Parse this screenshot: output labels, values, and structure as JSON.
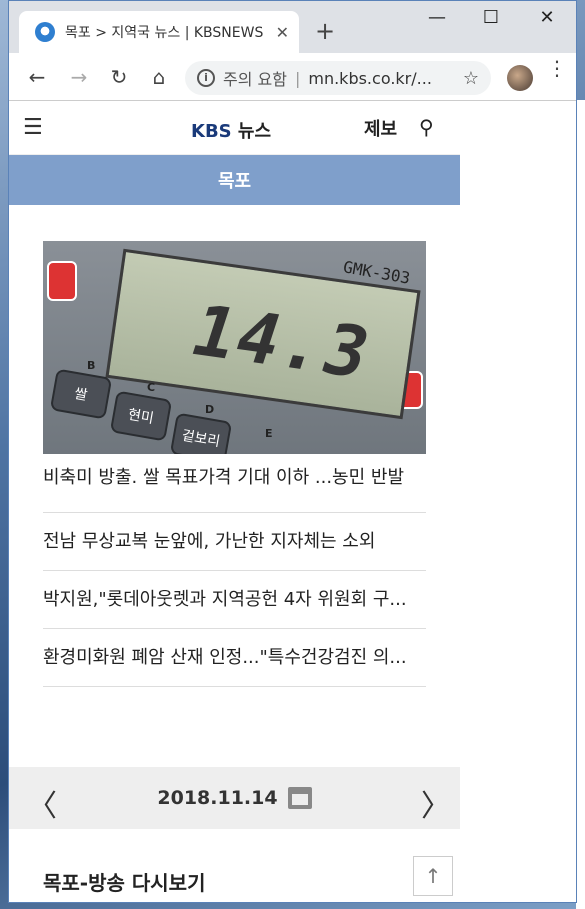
{
  "browser": {
    "tab_title": "목포 > 지역국 뉴스 | KBSNEWS",
    "tab_close": "✕",
    "new_tab": "+",
    "window_min": "—",
    "window_max": "☐",
    "window_close": "✕",
    "security_label": "주의 요함",
    "url": "mn.kbs.co.kr/...",
    "back": "←",
    "forward": "→",
    "reload": "↻",
    "home": "⌂",
    "star": "☆",
    "menu": "⋮",
    "info": "i"
  },
  "site": {
    "menu_icon": "☰",
    "logo_kbs": "KBS",
    "logo_news": "뉴스",
    "report_label": "제보",
    "search_icon": "⚲",
    "region": "목포"
  },
  "thumbnail": {
    "digits": "14.3",
    "device_label": "GMK-303",
    "keys": [
      "쌀",
      "현미",
      "겉보리"
    ],
    "key_letters": [
      "B",
      "C",
      "D",
      "E"
    ]
  },
  "news": {
    "headline": "비축미 방출. 쌀 목표가격 기대 이하 ...농민 반발",
    "items": [
      "전남 무상교복 눈앞에, 가난한 지자체는 소외",
      "박지원,\"롯데아웃렛과 지역공헌 4자 위원회 구...",
      "환경미화원 폐암 산재 인정...\"특수건강검진 의..."
    ]
  },
  "date_nav": {
    "prev": "〈",
    "next": "〉",
    "date": "2018.11.14"
  },
  "replay": {
    "title": "목포-방송 다시보기",
    "top_button": "↑"
  }
}
